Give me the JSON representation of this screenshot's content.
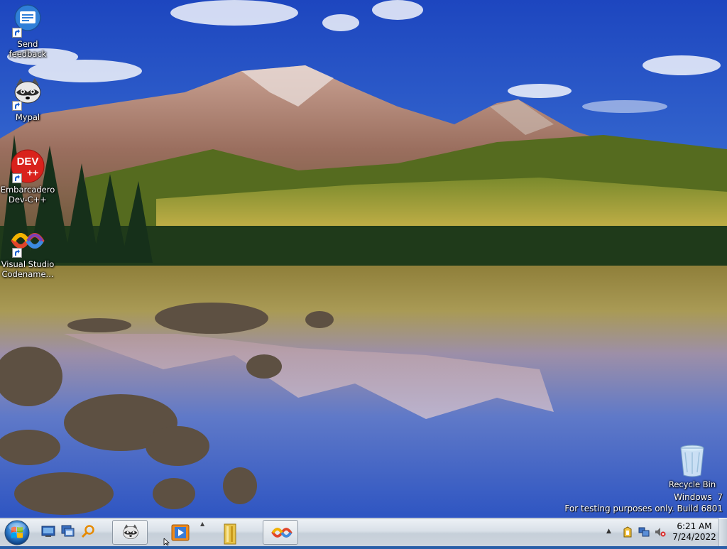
{
  "desktop": {
    "icons": [
      {
        "label": "Send\nfeedback",
        "icon": "send-feedback-icon"
      },
      {
        "label": "Mypal",
        "icon": "mypal-raccoon-icon"
      },
      {
        "label": "Embarcadero\nDev-C++",
        "icon": "devcpp-icon",
        "badge_top": "DEV",
        "badge_bottom": "++"
      },
      {
        "label": "Visual Studio\nCodename...",
        "icon": "visual-studio-icon"
      },
      {
        "label": "Recycle Bin",
        "icon": "recycle-bin-icon"
      }
    ]
  },
  "watermark": {
    "line1": "Windows  7",
    "line2": "For testing purposes only. Build 6801"
  },
  "taskbar": {
    "start_icon": "windows-orb-icon",
    "quick_launch": [
      "show-desktop-icon",
      "switch-windows-icon",
      "search-icon"
    ],
    "tasks": [
      {
        "icon": "mypal-raccoon-icon",
        "active": true
      },
      {
        "icon": "media-player-icon",
        "active": false
      },
      {
        "icon": "file-manager-icon",
        "active": false
      },
      {
        "icon": "visual-studio-icon",
        "active": true
      }
    ],
    "tray_icons": [
      "show-hidden-icons-icon",
      "action-center-icon",
      "network-icon",
      "volume-muted-icon"
    ],
    "clock": {
      "time": "6:21 AM",
      "date": "7/24/2022"
    }
  },
  "colors": {
    "sky_top": "#1e4fc4",
    "sky_bottom": "#8cb6ee",
    "taskbar": "#d4dbe3"
  }
}
